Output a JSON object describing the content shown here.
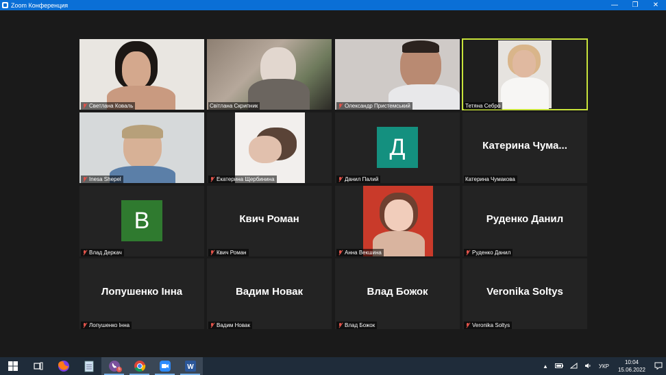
{
  "window": {
    "title": "Zoom Конференция"
  },
  "participants": [
    {
      "name": "Светлана Коваль",
      "muted": true
    },
    {
      "name": "Світлана Скрипник",
      "muted": false
    },
    {
      "name": "Олександр Пристемський",
      "muted": true
    },
    {
      "name": "Тетяна Себро",
      "muted": false,
      "active_speaker": true
    },
    {
      "name": "Inesa Shepel",
      "muted": true
    },
    {
      "name": "Екатерина Щербинина",
      "muted": true
    },
    {
      "name": "Данил Палий",
      "muted": true,
      "avatar_letter": "Д",
      "avatar_color": "#14907f"
    },
    {
      "name": "Катерина Чумакова",
      "muted": false,
      "display_name": "Катерина  Чума..."
    },
    {
      "name": "Влад Деркач",
      "muted": true,
      "avatar_letter": "В",
      "avatar_color": "#2f7a2f"
    },
    {
      "name": "Квич Роман",
      "muted": true,
      "display_name": "Квич Роман"
    },
    {
      "name": "Анна Векшина",
      "muted": true
    },
    {
      "name": "Руденко Данил",
      "muted": true,
      "display_name": "Руденко Данил"
    },
    {
      "name": "Лопушенко Інна",
      "muted": true,
      "display_name": "Лопушенко Інна"
    },
    {
      "name": "Вадим Новак",
      "muted": true,
      "display_name": "Вадим Новак"
    },
    {
      "name": "Влад Божок",
      "muted": true,
      "display_name": "Влад Божок"
    },
    {
      "name": "Veronika Soltys",
      "muted": true,
      "display_name": "Veronika Soltys"
    }
  ],
  "taskbar": {
    "apps": [
      "windows-start-icon",
      "task-view-icon",
      "firefox-icon",
      "notepad-icon",
      "viber-icon",
      "chrome-icon",
      "zoom-icon",
      "word-icon"
    ],
    "viber_badge": "5",
    "language": "УКР",
    "time": "10:04",
    "date": "15.06.2022"
  },
  "colors": {
    "titlebar": "#0a6fd6",
    "stage": "#1a1a1a",
    "tile": "#232323",
    "active_border": "#c8e33a",
    "taskbar": "#1f2c3a"
  }
}
